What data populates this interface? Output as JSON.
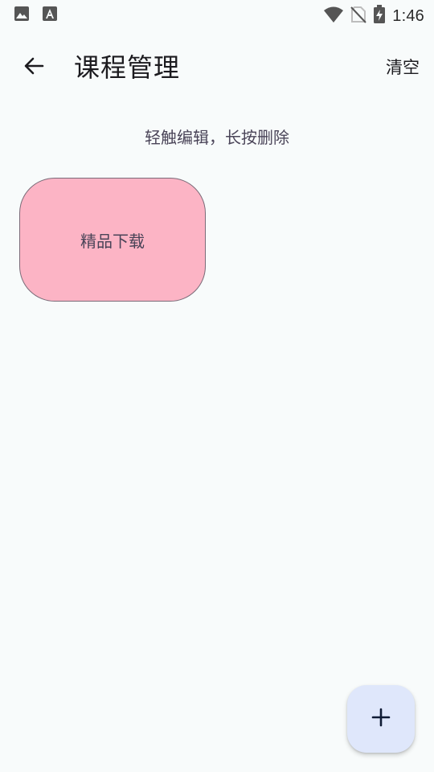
{
  "status_bar": {
    "time": "1:46",
    "left_icons": [
      "image-icon",
      "font-a-icon"
    ],
    "right_icons": [
      "wifi-icon",
      "no-sim-icon",
      "battery-charging-icon"
    ]
  },
  "app_bar": {
    "title": "课程管理",
    "back_icon": "arrow-back-icon",
    "clear_label": "清空"
  },
  "hint": "轻触编辑，长按删除",
  "courses": [
    {
      "name": "精品下载",
      "color": "#fcb4c5"
    }
  ],
  "fab": {
    "icon": "plus-icon",
    "color": "#dfe7fb"
  },
  "colors": {
    "background": "#f8fbfb",
    "text_primary": "#1c1b1f",
    "text_secondary": "#4a4458"
  }
}
